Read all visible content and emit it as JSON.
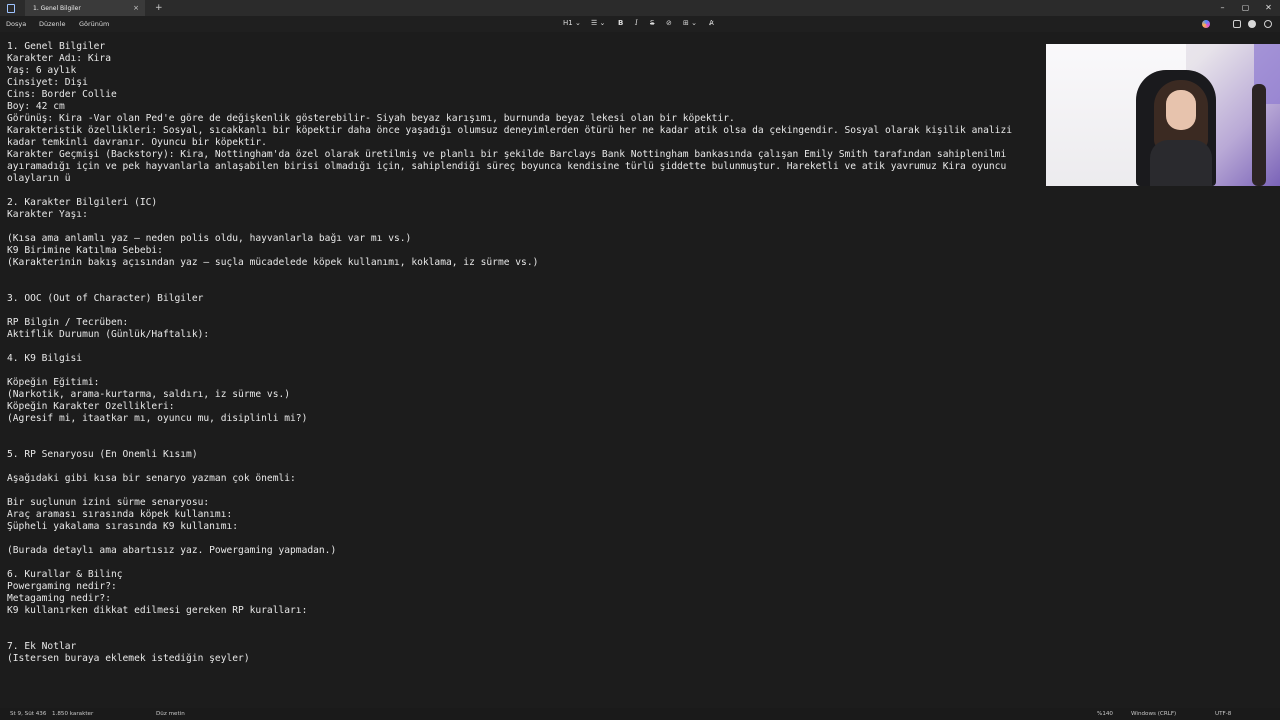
{
  "titlebar": {
    "tab_title": "1. Genel Bilgiler",
    "tab_close": "×",
    "new_tab": "+",
    "minimize": "–",
    "maximize": "▢",
    "close": "✕"
  },
  "menu": {
    "file": "Dosya",
    "edit": "Düzenle",
    "view": "Görünüm"
  },
  "toolbar": {
    "heading": "H1 ⌄",
    "list": "☰ ⌄",
    "bold": "B",
    "italic": "I",
    "strike": "S",
    "link": "⊘",
    "table": "⊞ ⌄",
    "clear_format": "A̷"
  },
  "document": {
    "lines": [
      "1. Genel Bilgiler",
      "Karakter Adı: Kira",
      "Yaş: 6 aylık",
      "Cinsiyet: Dişi",
      "Cins: Border Collie",
      "Boy: 42 cm",
      "Görünüş: Kira -Var olan Ped'e göre de değişkenlik gösterebilir- Siyah beyaz karışımı, burnunda beyaz lekesi olan bir köpektir.",
      "Karakteristik özellikleri: Sosyal, sıcakkanlı bir köpektir daha önce yaşadığı olumsuz deneyimlerden ötürü her ne kadar atik olsa da çekingendir. Sosyal olarak kişilik analizi",
      "kadar temkinli davranır. Oyuncu bir köpektir.",
      "Karakter Geçmişi (Backstory): Kira, Nottingham'da özel olarak üretilmiş ve planlı bir şekilde Barclays Bank Nottingham bankasında çalışan Emily Smith tarafından sahiplenilmi",
      "ayıramadığı için ve pek hayvanlarla anlaşabilen birisi olmadığı için, sahiplendiği süreç boyunca kendisine türlü şiddette bulunmuştur. Hareketli ve atik yavrumuz Kira oyuncu",
      "olayların ü",
      "",
      "2. Karakter Bilgileri (IC)",
      "Karakter Yaşı:",
      "",
      "(Kısa ama anlamlı yaz — neden polis oldu, hayvanlarla bağı var mı vs.)",
      "K9 Birimine Katılma Sebebi:",
      "(Karakterinin bakış açısından yaz — suçla mücadelede köpek kullanımı, koklama, iz sürme vs.)",
      "",
      "",
      "3. OOC (Out of Character) Bilgiler",
      "",
      "RP Bilgin / Tecrüben:",
      "Aktiflik Durumun (Günlük/Haftalık):",
      "",
      "4. K9 Bilgisi",
      "",
      "Köpeğin Eğitimi:",
      "(Narkotik, arama-kurtarma, saldırı, iz sürme vs.)",
      "Köpeğin Karakter Özellikleri:",
      "(Agresif mi, itaatkar mı, oyuncu mu, disiplinli mi?)",
      "",
      "",
      "5. RP Senaryosu (En Önemli Kısım)",
      "",
      "Aşağıdaki gibi kısa bir senaryo yazman çok önemli:",
      "",
      "Bir suçlunun izini sürme senaryosu:",
      "Araç araması sırasında köpek kullanımı:",
      "Şüpheli yakalama sırasında K9 kullanımı:",
      "",
      "(Burada detaylı ama abartısız yaz. Powergaming yapmadan.)",
      "",
      "6. Kurallar & Bilinç",
      "Powergaming nedir?:",
      "Metagaming nedir?:",
      "K9 kullanırken dikkat edilmesi gereken RP kuralları:",
      "",
      "",
      "7. Ek Notlar",
      "(İstersen buraya eklemek istediğin şeyler)"
    ]
  },
  "status": {
    "position": "St 9, Süt 436",
    "chars": "1.850 karakter",
    "mode": "Düz metin",
    "zoom": "%140",
    "line_ending": "Windows (CRLF)",
    "encoding": "UTF-8"
  }
}
